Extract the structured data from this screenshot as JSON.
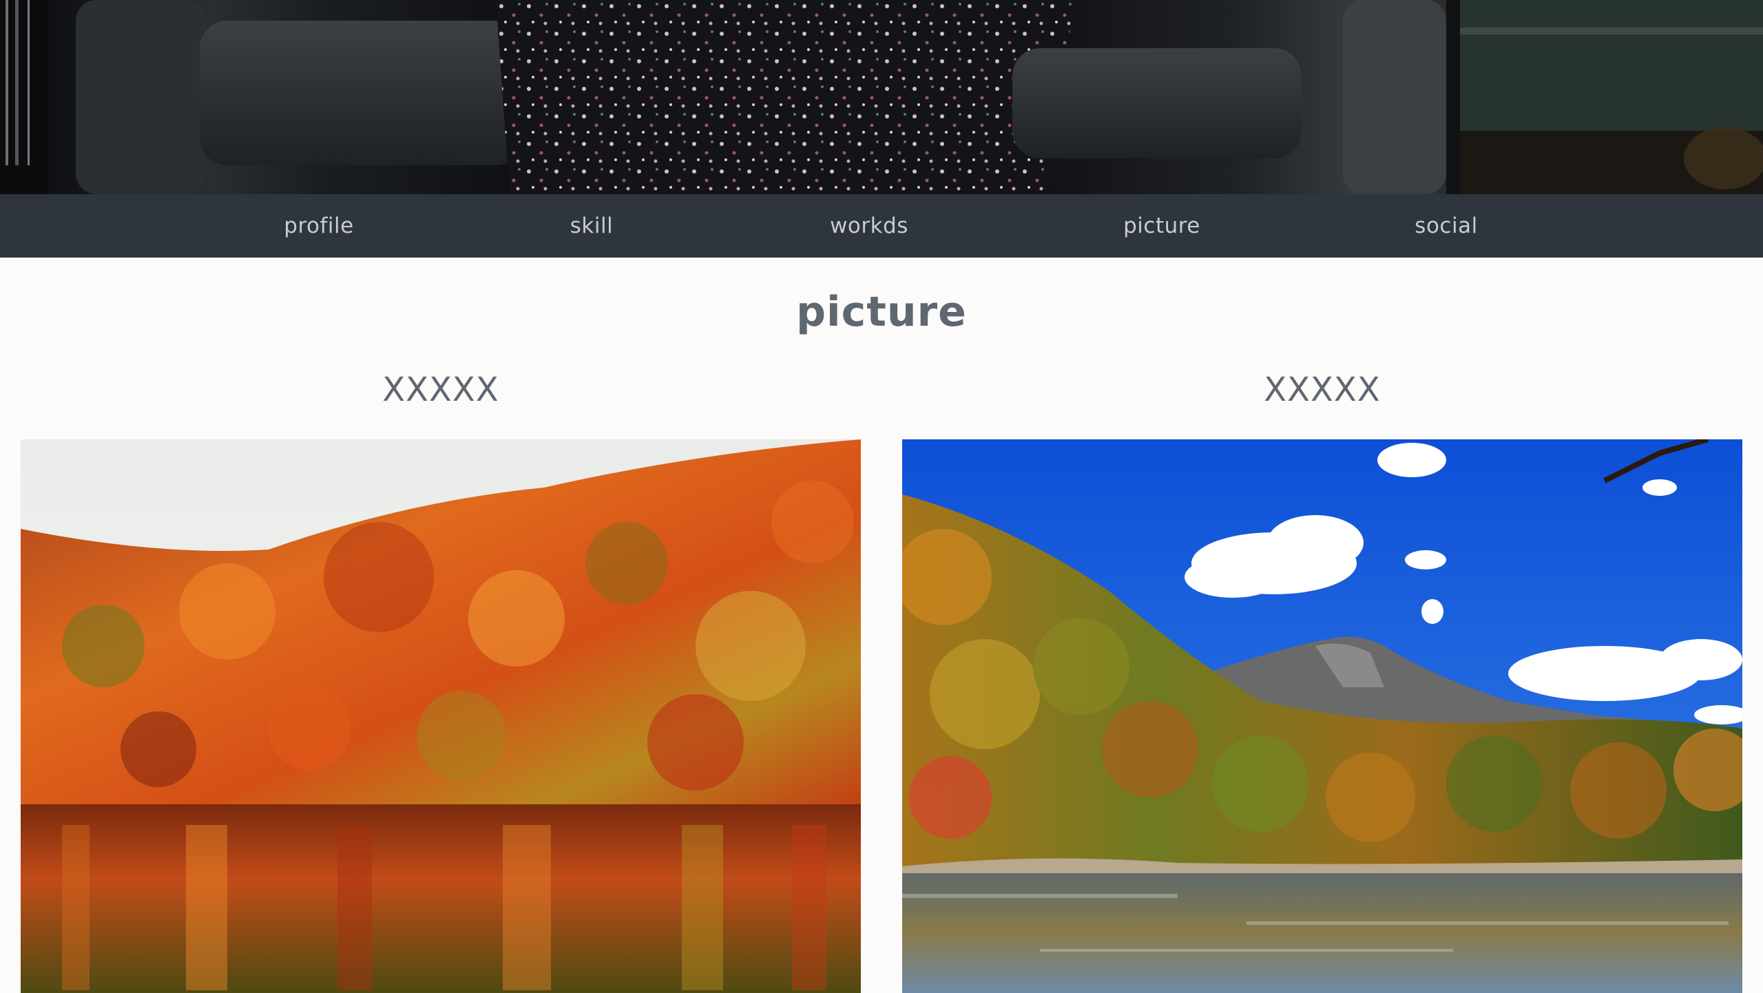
{
  "nav": {
    "items": [
      {
        "label": "profile"
      },
      {
        "label": "skill"
      },
      {
        "label": "workds"
      },
      {
        "label": "picture"
      },
      {
        "label": "social"
      }
    ]
  },
  "main": {
    "section_title": "picture",
    "cards": [
      {
        "title": "XXXXX",
        "image_subject": "autumn forest hillside reflected in a lake"
      },
      {
        "title": "XXXXX",
        "image_subject": "autumn forest lake with mountain and blue sky"
      }
    ]
  },
  "colors": {
    "navbar_bg": "#2f353c",
    "nav_text": "#c8ccd0",
    "heading_text": "#5f6770",
    "page_bg": "#fdfafa"
  }
}
